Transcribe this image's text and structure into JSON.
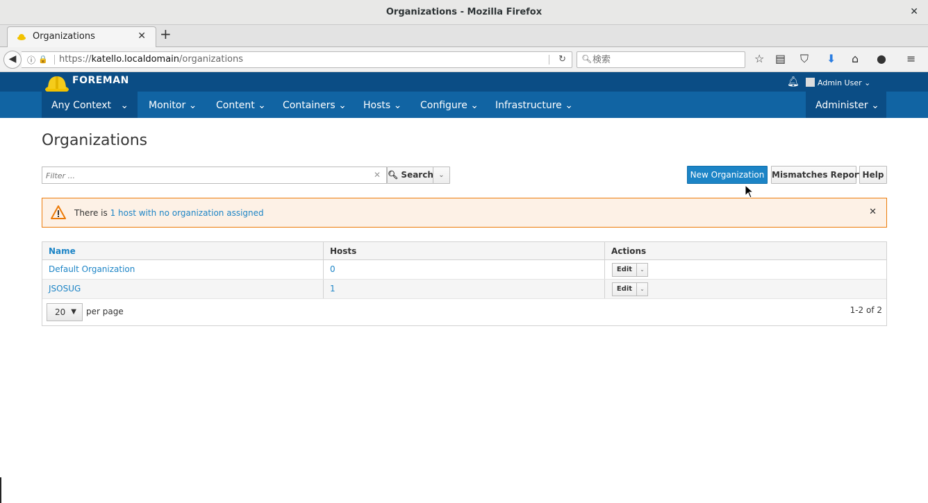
{
  "window": {
    "title": "Organizations - Mozilla Firefox"
  },
  "browser": {
    "tab_label": "Organizations",
    "url_prefix": "https://",
    "url_host": "katello.localdomain",
    "url_path": "/organizations",
    "search_placeholder": "検索"
  },
  "header": {
    "brand": "FOREMAN",
    "user": "Admin User",
    "nav": {
      "context": "Any Context",
      "items": [
        "Monitor",
        "Content",
        "Containers",
        "Hosts",
        "Configure",
        "Infrastructure"
      ],
      "administer": "Administer"
    }
  },
  "main": {
    "title": "Organizations",
    "filter_placeholder": "Filter ...",
    "search_label": "Search",
    "new_button": "New Organization",
    "mismatches_button": "Mismatches Report",
    "help_button": "Help",
    "alert": {
      "prefix": "There is ",
      "link": "1 host with no organization assigned"
    },
    "table": {
      "columns": [
        "Name",
        "Hosts",
        "Actions"
      ],
      "rows": [
        {
          "name": "Default Organization",
          "hosts": "0",
          "action": "Edit"
        },
        {
          "name": "JSOSUG",
          "hosts": "1",
          "action": "Edit"
        }
      ],
      "per_page_value": "20",
      "per_page_label": "per page",
      "count": "1-2 of 2"
    }
  },
  "colors": {
    "foreman_header": "#0b4d85",
    "foreman_nav": "#1164a3",
    "primary": "#1c84c6",
    "warning": "#ec7a08"
  }
}
